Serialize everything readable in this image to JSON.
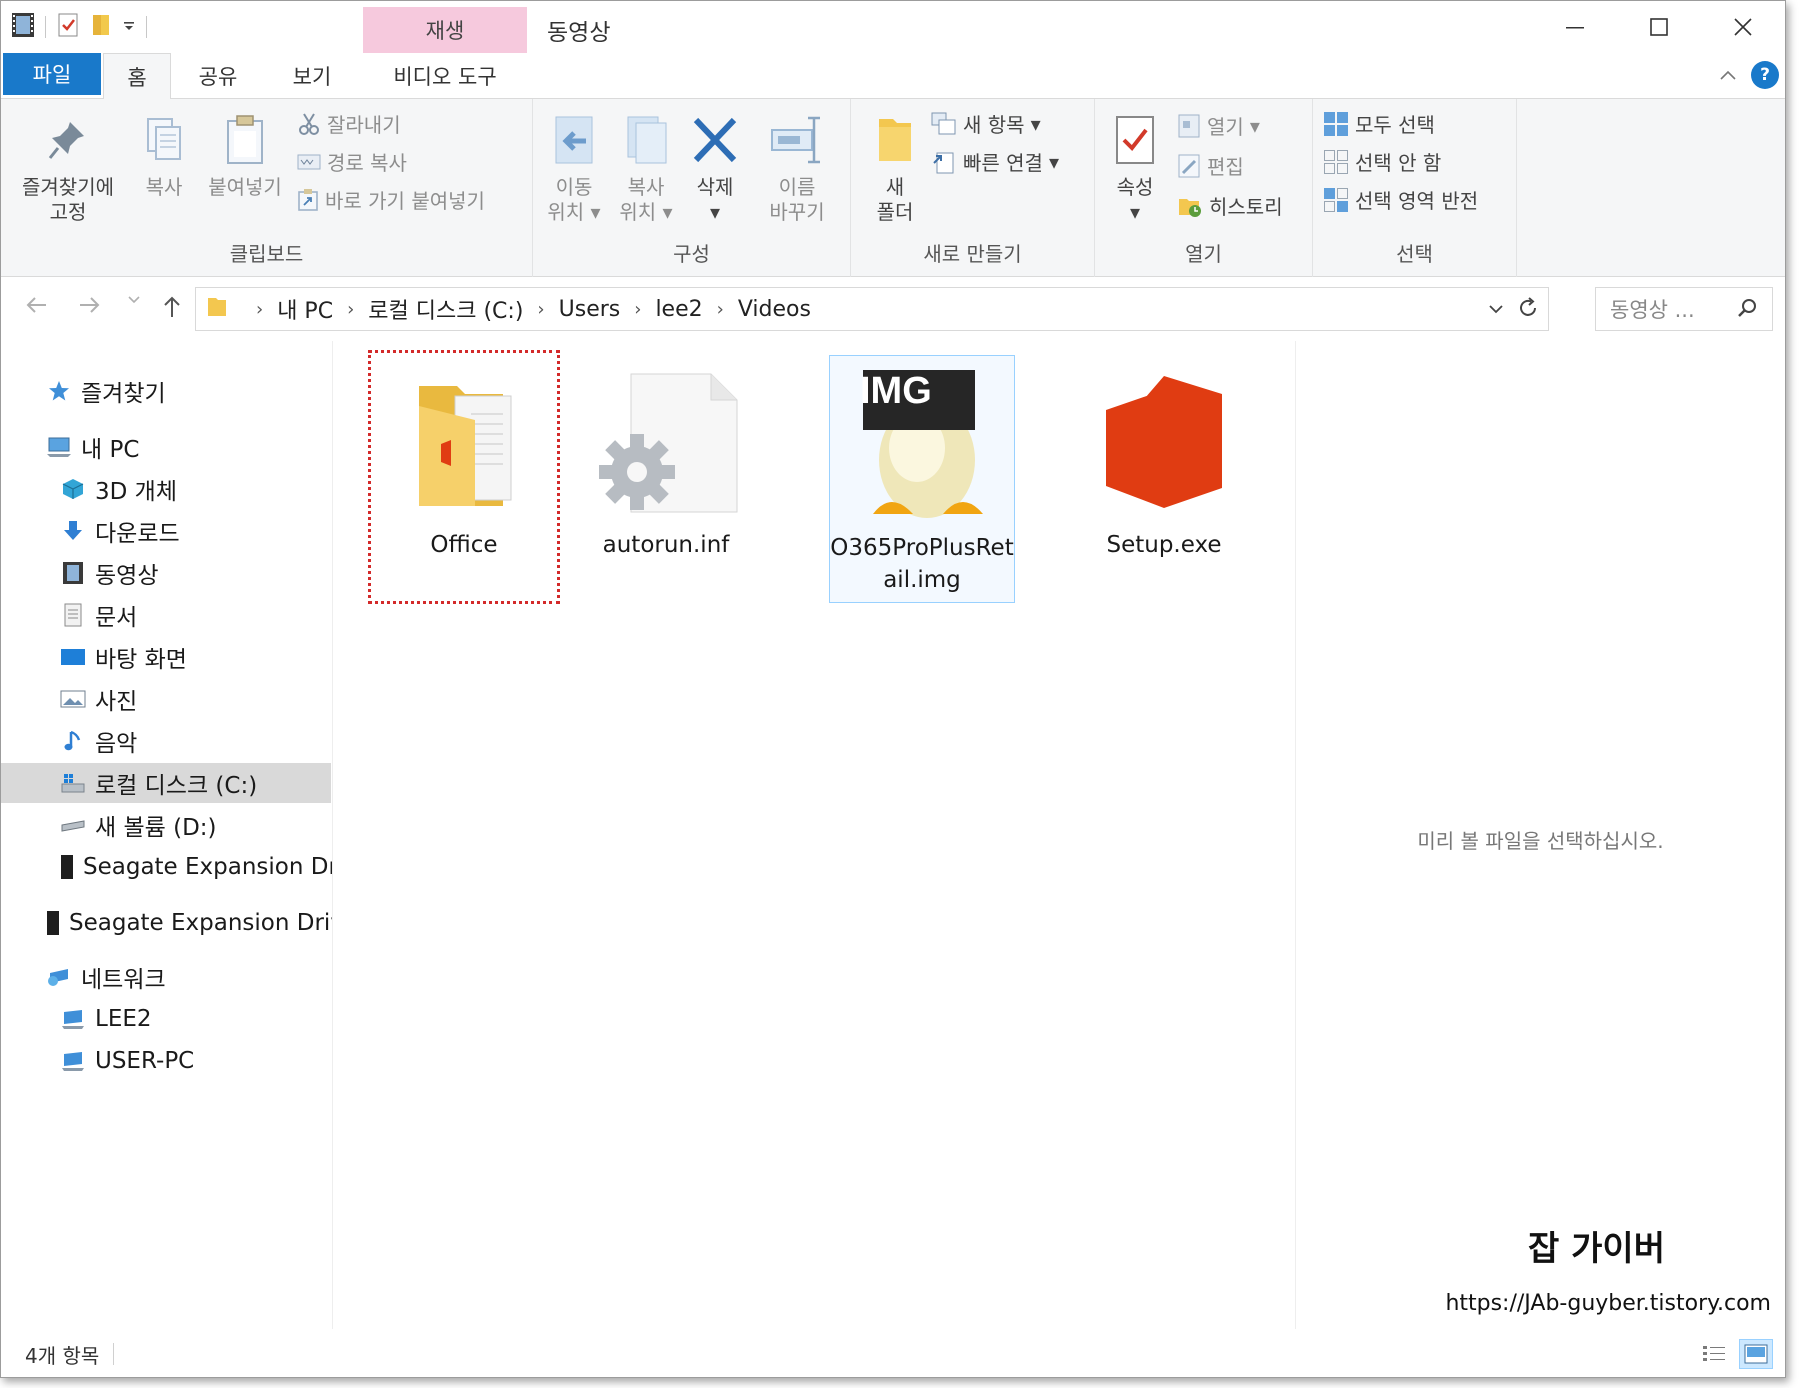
{
  "window": {
    "title": "동영상",
    "context_tab": "재생",
    "controls": [
      "minimize-icon",
      "maximize-icon",
      "close-icon"
    ]
  },
  "ribbon_tabs": {
    "file": "파일",
    "home": "홈",
    "share": "공유",
    "view": "보기",
    "video_tools": "비디오 도구"
  },
  "ribbon": {
    "clipboard": {
      "label": "클립보드",
      "pin_line1": "즐겨찾기에",
      "pin_line2": "고정",
      "copy": "복사",
      "paste": "붙여넣기",
      "cut": "잘라내기",
      "copy_path": "경로 복사",
      "paste_shortcut": "바로 가기 붙여넣기"
    },
    "organize": {
      "label": "구성",
      "move_line1": "이동",
      "move_line2": "위치",
      "copyto_line1": "복사",
      "copyto_line2": "위치",
      "delete": "삭제",
      "rename_line1": "이름",
      "rename_line2": "바꾸기"
    },
    "new": {
      "label": "새로 만들기",
      "folder_line1": "새",
      "folder_line2": "폴더",
      "new_item": "새 항목",
      "easy_access": "빠른 연결"
    },
    "open": {
      "label": "열기",
      "properties": "속성",
      "open": "열기",
      "edit": "편집",
      "history": "히스토리"
    },
    "select": {
      "label": "선택",
      "select_all": "모두 선택",
      "select_none": "선택 안 함",
      "invert": "선택 영역 반전"
    }
  },
  "address": {
    "crumbs": [
      "내 PC",
      "로컬 디스크 (C:)",
      "Users",
      "lee2",
      "Videos"
    ],
    "search_placeholder": "동영상 ..."
  },
  "nav_pane": {
    "items": [
      {
        "label": "즐겨찾기",
        "icon": "star-icon"
      },
      {
        "label": "내 PC",
        "icon": "computer-icon"
      },
      {
        "label": "3D 개체",
        "icon": "cube-icon"
      },
      {
        "label": "다운로드",
        "icon": "download-icon"
      },
      {
        "label": "동영상",
        "icon": "film-icon"
      },
      {
        "label": "문서",
        "icon": "document-icon"
      },
      {
        "label": "바탕 화면",
        "icon": "desktop-icon"
      },
      {
        "label": "사진",
        "icon": "picture-icon"
      },
      {
        "label": "음악",
        "icon": "music-icon"
      },
      {
        "label": "로컬 디스크 (C:)",
        "icon": "windows-drive-icon"
      },
      {
        "label": "새 볼륨 (D:)",
        "icon": "drive-icon"
      },
      {
        "label": "Seagate Expansion Dr",
        "icon": "external-drive-icon"
      },
      {
        "label": "Seagate Expansion Driv",
        "icon": "external-drive-icon"
      },
      {
        "label": "네트워크",
        "icon": "network-icon"
      },
      {
        "label": "LEE2",
        "icon": "network-computer-icon"
      },
      {
        "label": "USER-PC",
        "icon": "network-computer-icon"
      }
    ]
  },
  "files": [
    {
      "name": "Office",
      "icon": "office-folder-icon"
    },
    {
      "name": "autorun.inf",
      "icon": "settings-file-icon"
    },
    {
      "name": "O365ProPlusRetail.img",
      "icon": "disc-image-icon",
      "badge": "IMG"
    },
    {
      "name": "Setup.exe",
      "icon": "office-logo-icon"
    }
  ],
  "preview": {
    "message": "미리 볼 파일을 선택하십시오.",
    "watermark_title": "잡 가이버",
    "watermark_url": "https://JAb-guyber.tistory.com"
  },
  "status": {
    "item_count": "4개 항목"
  },
  "colors": {
    "accent": "#1979ca",
    "context_tab": "#f6c9dd",
    "office_red": "#e03c12",
    "focus_dots": "#d32a2a"
  }
}
